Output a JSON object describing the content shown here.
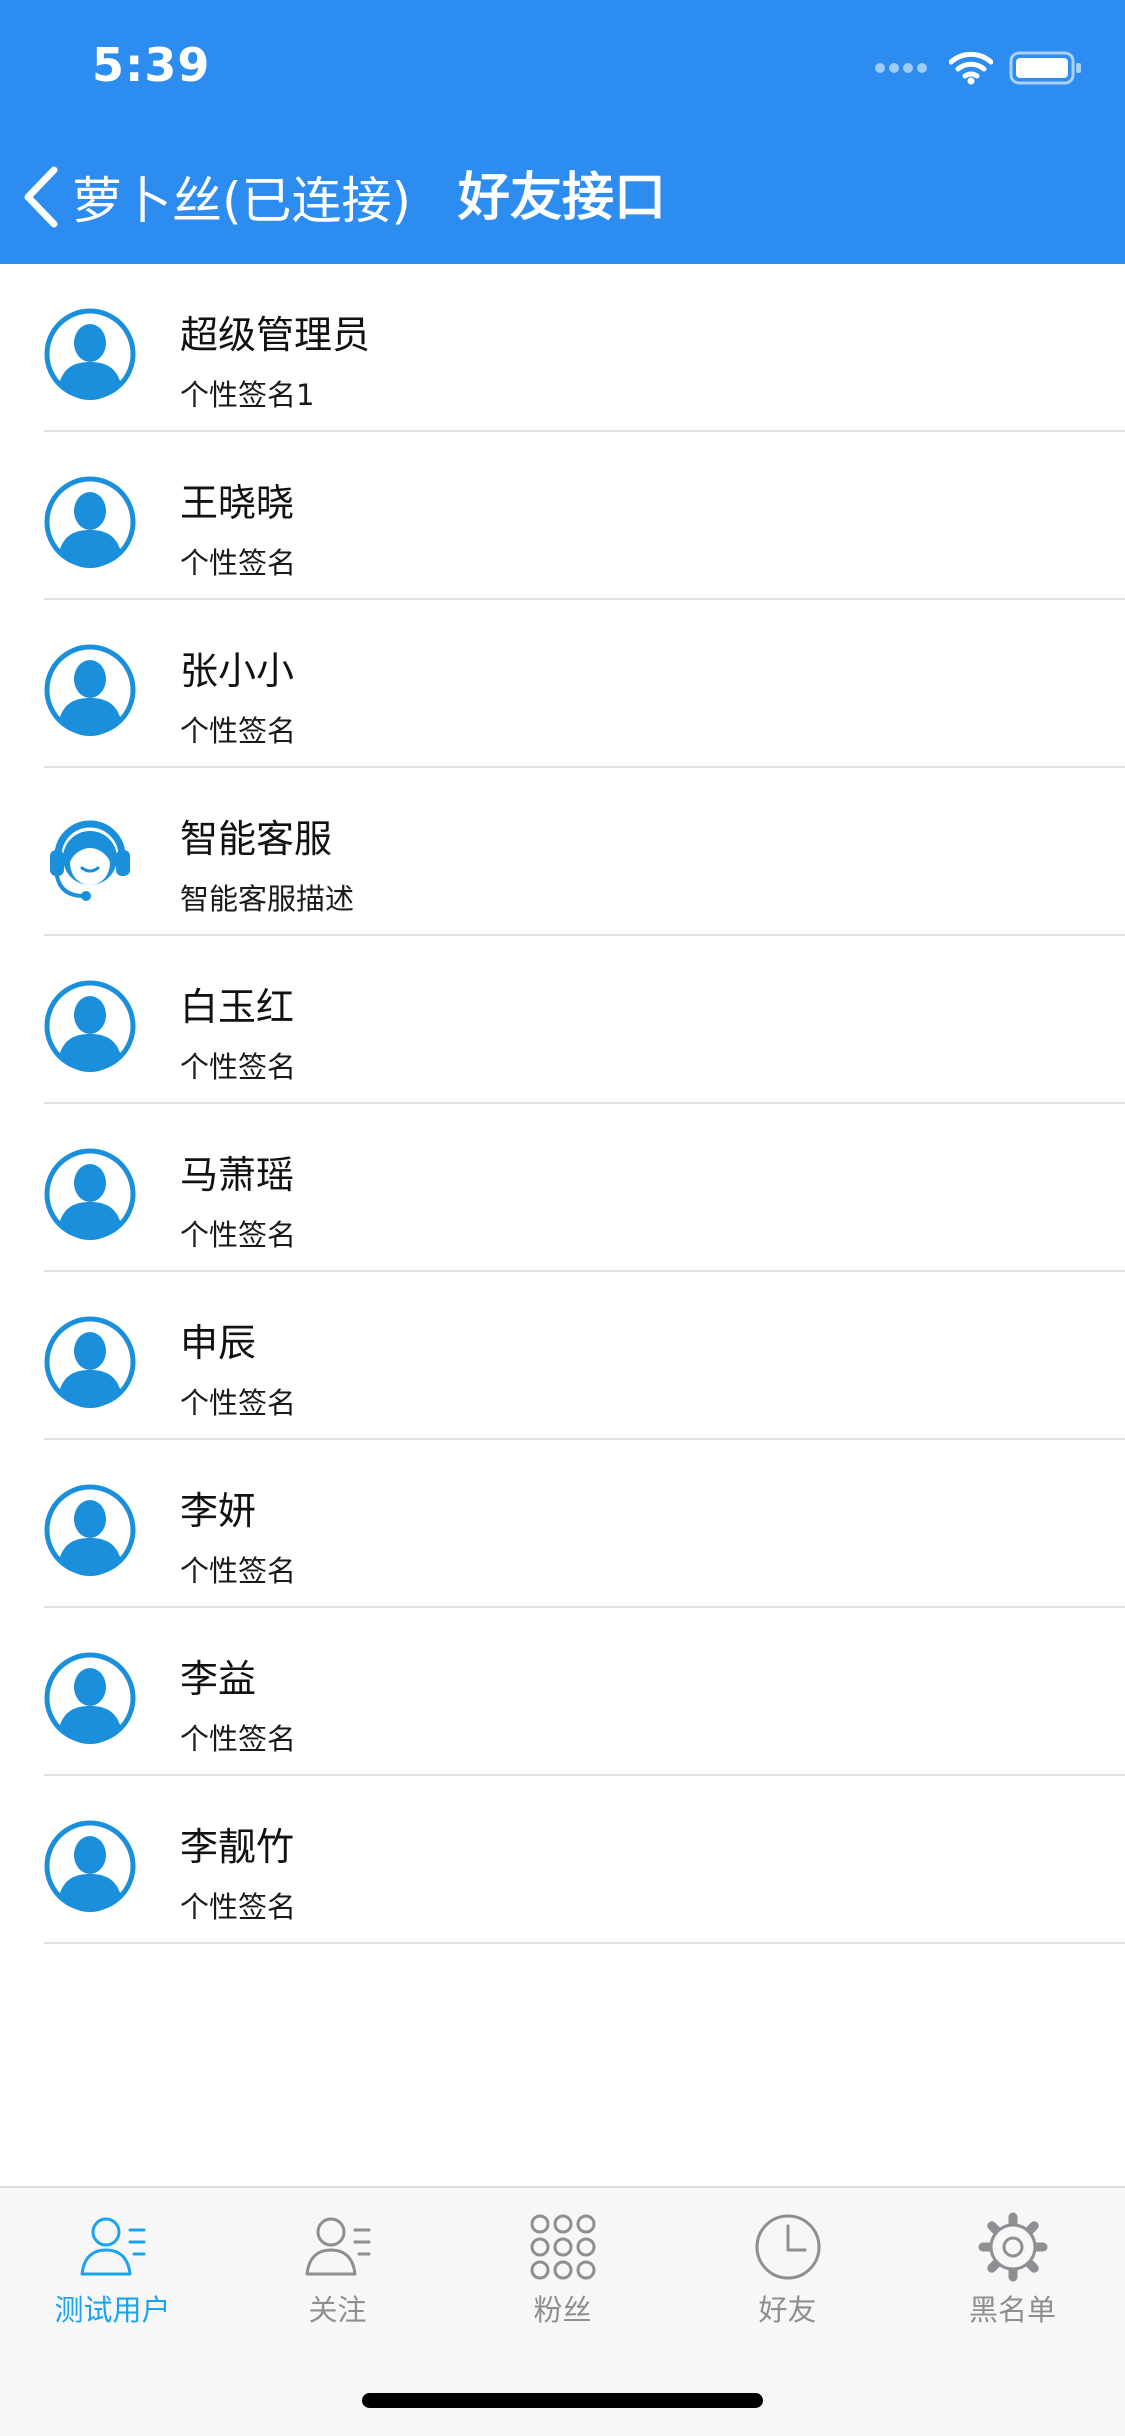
{
  "status_bar": {
    "time": "5:39"
  },
  "nav": {
    "back_label": "萝卜丝(已连接)",
    "title": "好友接口"
  },
  "colors": {
    "header_bg": "#2d8cf0",
    "accent": "#1aa3ee",
    "avatar_blue": "#1a8fdc",
    "tab_inactive": "#8e8e93"
  },
  "contacts": [
    {
      "name": "超级管理员",
      "signature": "个性签名1",
      "avatar": "person-avatar-icon"
    },
    {
      "name": "王晓晓",
      "signature": "个性签名",
      "avatar": "person-avatar-icon"
    },
    {
      "name": "张小小",
      "signature": "个性签名",
      "avatar": "person-avatar-icon"
    },
    {
      "name": "智能客服",
      "signature": "智能客服描述",
      "avatar": "headset-agent-icon"
    },
    {
      "name": "白玉红",
      "signature": "个性签名",
      "avatar": "person-avatar-icon"
    },
    {
      "name": "马萧瑶",
      "signature": "个性签名",
      "avatar": "person-avatar-icon"
    },
    {
      "name": "申辰",
      "signature": "个性签名",
      "avatar": "person-avatar-icon"
    },
    {
      "name": "李妍",
      "signature": "个性签名",
      "avatar": "person-avatar-icon"
    },
    {
      "name": "李益",
      "signature": "个性签名",
      "avatar": "person-avatar-icon"
    },
    {
      "name": "李靓竹",
      "signature": "个性签名",
      "avatar": "person-avatar-icon"
    }
  ],
  "tabbar": {
    "tabs": [
      {
        "label": "测试用户",
        "icon": "user-list-icon",
        "active": true
      },
      {
        "label": "关注",
        "icon": "user-list-icon",
        "active": false
      },
      {
        "label": "粉丝",
        "icon": "grid-dots-icon",
        "active": false
      },
      {
        "label": "好友",
        "icon": "clock-icon",
        "active": false
      },
      {
        "label": "黑名单",
        "icon": "gear-icon",
        "active": false
      }
    ]
  }
}
